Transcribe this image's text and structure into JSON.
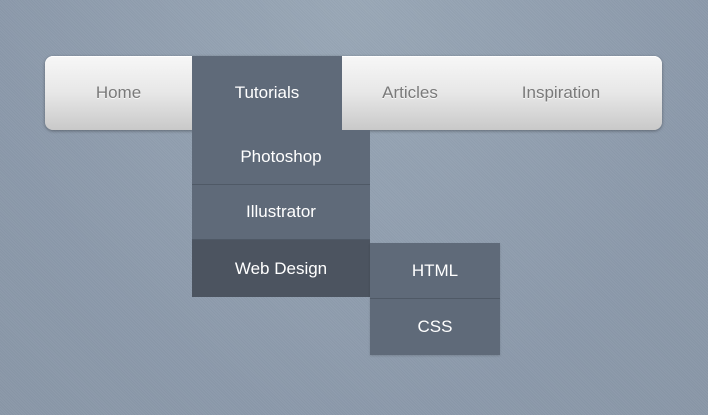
{
  "nav": {
    "items": [
      {
        "label": "Home"
      },
      {
        "label": "Tutorials",
        "active": true
      },
      {
        "label": "Articles"
      },
      {
        "label": "Inspiration"
      }
    ]
  },
  "dropdown": {
    "items": [
      {
        "label": "Photoshop"
      },
      {
        "label": "Illustrator"
      },
      {
        "label": "Web Design",
        "active": true
      }
    ]
  },
  "submenu": {
    "items": [
      {
        "label": "HTML"
      },
      {
        "label": "CSS"
      }
    ]
  },
  "colors": {
    "background": "#8f9eae",
    "menu_active": "#5f6a79",
    "menu_hover": "#4c5460",
    "navbar_top": "#f7f7f7",
    "navbar_bottom": "#c9c9c9",
    "nav_text": "#7a7a7a"
  }
}
